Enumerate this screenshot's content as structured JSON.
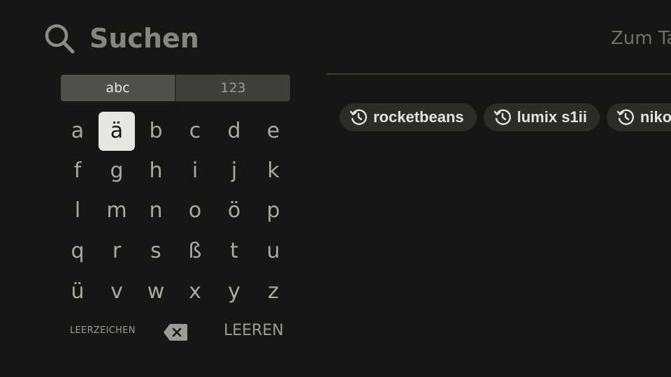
{
  "header": {
    "title": "Suchen",
    "right_text": "Zum Ta"
  },
  "keyboard": {
    "modes": [
      "abc",
      "123"
    ],
    "active_mode": "abc",
    "rows": [
      [
        "a",
        "ä",
        "b",
        "c",
        "d",
        "e"
      ],
      [
        "f",
        "g",
        "h",
        "i",
        "j",
        "k"
      ],
      [
        "l",
        "m",
        "n",
        "o",
        "ö",
        "p"
      ],
      [
        "q",
        "r",
        "s",
        "ß",
        "t",
        "u"
      ],
      [
        "ü",
        "v",
        "w",
        "x",
        "y",
        "z"
      ]
    ],
    "focused_key": "ä",
    "space_label": "LEERZEICHEN",
    "clear_label": "LEEREN"
  },
  "recent_searches": [
    "rocketbeans",
    "lumix s1ii",
    "nikon"
  ],
  "icons": {
    "search": "search-icon",
    "backspace": "backspace-icon",
    "history": "history-icon"
  }
}
